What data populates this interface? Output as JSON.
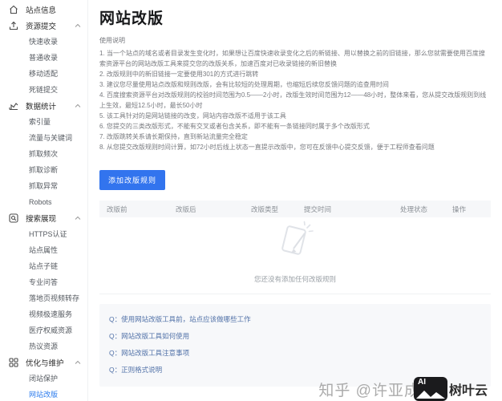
{
  "sidebar": {
    "site_info": "站点信息",
    "sections": [
      {
        "label": "资源提交",
        "items": [
          "快速收录",
          "普通收录",
          "移动适配",
          "死链提交"
        ]
      },
      {
        "label": "数据统计",
        "items": [
          "索引量",
          "流量与关键词",
          "抓取频次",
          "抓取诊断",
          "抓取异常",
          "Robots"
        ]
      },
      {
        "label": "搜索展现",
        "items": [
          "HTTPS认证",
          "站点属性",
          "站点子链",
          "专业问答",
          "落地页视频转存",
          "视频极速服务",
          "医疗权威资源",
          "热议资源"
        ]
      },
      {
        "label": "优化与维护",
        "items": [
          "闭站保护",
          "网站改版"
        ]
      }
    ],
    "active_item": "网站改版"
  },
  "main": {
    "title": "网站改版",
    "usage_label": "使用说明",
    "instructions": [
      "1. 当一个站点的域名或者目录发生变化时，如果想让百度快速收录变化之后的新链接、用以替换之前的旧链接，那么您就需要使用百度搜索资源平台的网站改版工具来提交您的改版关系，加速百度对已收录链接的新旧替换",
      "2. 改版规则中的新旧链接一定要使用301的方式进行跳转",
      "3. 建议您尽量使用站点改版和规则改版，会有比较短的处理周期，也缩短后续您反馈问题的追查用时间",
      "4. 百度搜索资源平台对改版规则的校验时间范围为0.5——2小时，改版生效时间范围为12——48小时，整体来看，您从提交改版规则到线上生效，最短12.5小时，最长50小时",
      "5. 该工具针对的是网站链接的改变，网站内容改版不适用于该工具",
      "6. 您提交的三类改版形式，不能有交叉或者包含关系，即不能有一条链接同时属于多个改版形式",
      "7. 改版跳转关系请长期保持，直到新站流量完全稳定",
      "8. 从您提交改版规则时间计算，如72小时后线上状态一直提示改版中，您可在反馈中心提交反馈，便于工程师查看问题"
    ],
    "add_button": "添加改版规则",
    "table_headers": [
      "改版前",
      "改版后",
      "改版类型",
      "提交时间",
      "处理状态",
      "操作"
    ],
    "empty_text": "您还没有添加任何改版规则",
    "faq": [
      "Q：使用网站改版工具前，站点应该做哪些工作",
      "Q：网站改版工具如何使用",
      "Q：网站改版工具注意事项",
      "Q：正则格式说明"
    ]
  },
  "watermark": {
    "text": "知乎 @许亚成",
    "logo_ai": "AI",
    "brand": "树叶云"
  },
  "colors": {
    "accent_blue": "#3274ee",
    "active_link": "#2b7bed",
    "faq_link": "#5272a8",
    "header_bg": "#f6f7f9"
  }
}
